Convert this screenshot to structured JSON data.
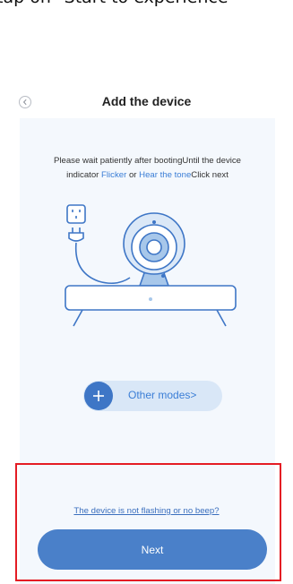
{
  "caption": "tap on \"Start to experience",
  "header": {
    "title": "Add the device",
    "back_icon": "chevron-left-icon"
  },
  "instructions": {
    "line1": "Please wait patiently after bootingUntil the device",
    "line2_prefix": "indicator ",
    "flicker": "Flicker",
    "or": " or ",
    "hear_tone": "Hear the tone",
    "line2_suffix": "Click next"
  },
  "illustration": {
    "icons": [
      "power-socket-icon",
      "power-plug-icon",
      "camera-icon",
      "tv-stand-icon"
    ]
  },
  "other_modes": {
    "label": "Other modes>",
    "icon": "plus-icon"
  },
  "help_link": "The device is not flashing or no beep?",
  "next_button": "Next",
  "colors": {
    "accent": "#4a80c9",
    "link": "#3b7ed6",
    "panel": "#f4f8fd",
    "highlight": "#e41c24"
  }
}
